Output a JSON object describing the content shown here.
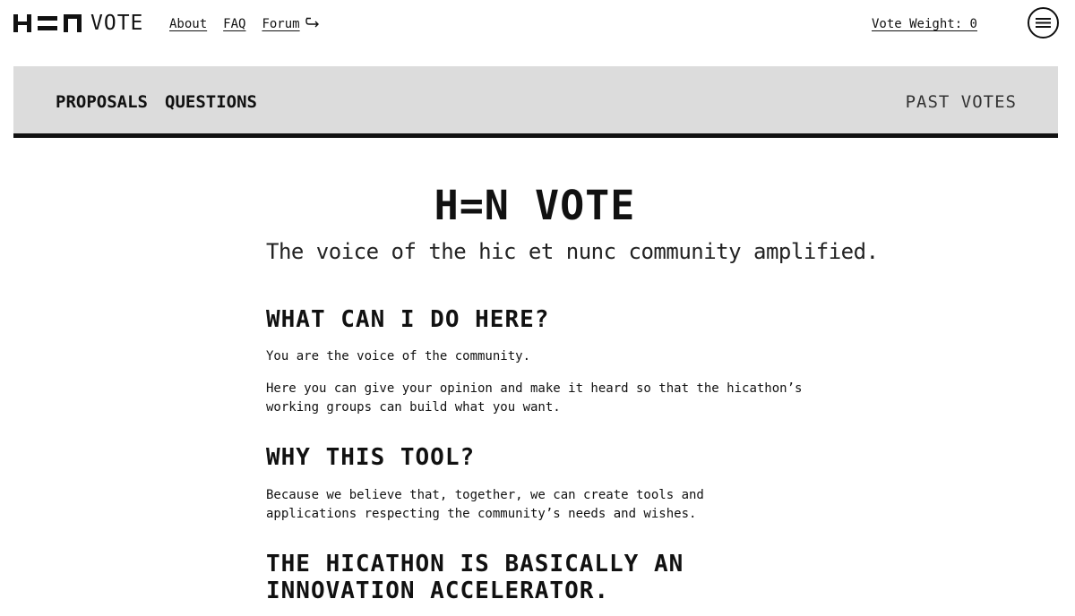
{
  "header": {
    "logo_text": "VOTE",
    "nav": [
      {
        "label": "About"
      },
      {
        "label": "FAQ"
      },
      {
        "label": "Forum"
      }
    ],
    "vote_weight": "Vote Weight: 0"
  },
  "tabs": {
    "proposals": "PROPOSALS",
    "questions": "QUESTIONS",
    "past_votes": "PAST VOTES"
  },
  "hero": {
    "title": "H=N VOTE",
    "subtitle": "The voice of the hic et nunc community amplified."
  },
  "sections": [
    {
      "heading": "WHAT CAN I DO HERE?",
      "paragraphs": [
        "You are the voice of the community.",
        "Here you can give your opinion and make it heard so that the hicathon’s working groups can build what you want."
      ]
    },
    {
      "heading": "WHY THIS TOOL?",
      "paragraphs": [
        "Because we believe that, together, we can create tools and applications respecting the community’s needs and wishes."
      ]
    },
    {
      "heading": "THE HICATHON IS BASICALLY AN INNOVATION ACCELERATOR."
    }
  ],
  "colors": {
    "tab_bar_bg": "#dcdcdc",
    "text": "#111111",
    "background": "#ffffff"
  },
  "icons": {
    "logo": "hen-logo-icon",
    "forum_external": "external-link-icon",
    "menu": "hamburger-menu-icon"
  }
}
